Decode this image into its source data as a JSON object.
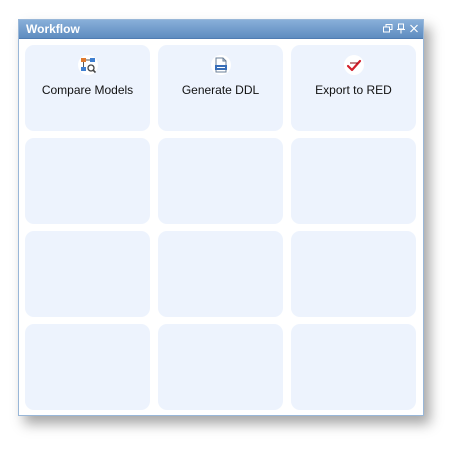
{
  "window": {
    "title": "Workflow"
  },
  "tiles": [
    {
      "label": "Compare Models",
      "icon": "compare-models-icon"
    },
    {
      "label": "Generate DDL",
      "icon": "generate-ddl-icon"
    },
    {
      "label": "Export to RED",
      "icon": "export-to-red-icon"
    },
    {
      "label": ""
    },
    {
      "label": ""
    },
    {
      "label": ""
    },
    {
      "label": ""
    },
    {
      "label": ""
    },
    {
      "label": ""
    },
    {
      "label": ""
    },
    {
      "label": ""
    },
    {
      "label": ""
    }
  ],
  "colors": {
    "titlebar_top": "#88afd9",
    "titlebar_bottom": "#5e8cc0",
    "tile_background": "#edf3fd",
    "panel_border": "#99b7d8"
  }
}
